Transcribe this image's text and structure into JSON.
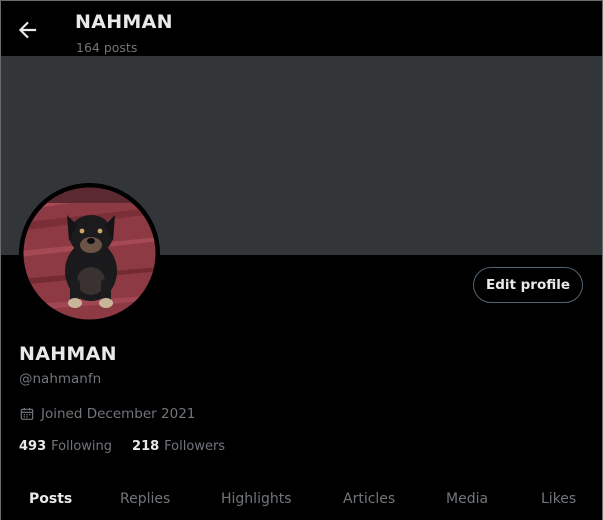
{
  "header": {
    "title": "NAHMAN",
    "post_count": "164 posts"
  },
  "profile": {
    "display_name": "NAHMAN",
    "handle": "@nahmanfn",
    "joined": "Joined December 2021",
    "edit_label": "Edit profile",
    "following_count": "493",
    "following_label": "Following",
    "followers_count": "218",
    "followers_label": "Followers"
  },
  "tabs": [
    {
      "label": "Posts",
      "active": true
    },
    {
      "label": "Replies",
      "active": false
    },
    {
      "label": "Highlights",
      "active": false
    },
    {
      "label": "Articles",
      "active": false
    },
    {
      "label": "Media",
      "active": false
    },
    {
      "label": "Likes",
      "active": false
    }
  ],
  "icons": {
    "back": "arrow-left-icon",
    "calendar": "calendar-icon"
  },
  "colors": {
    "background": "#000000",
    "banner": "#333639",
    "primary_text": "#e7e9ea",
    "secondary_text": "#71767b",
    "button_border": "#536471"
  }
}
